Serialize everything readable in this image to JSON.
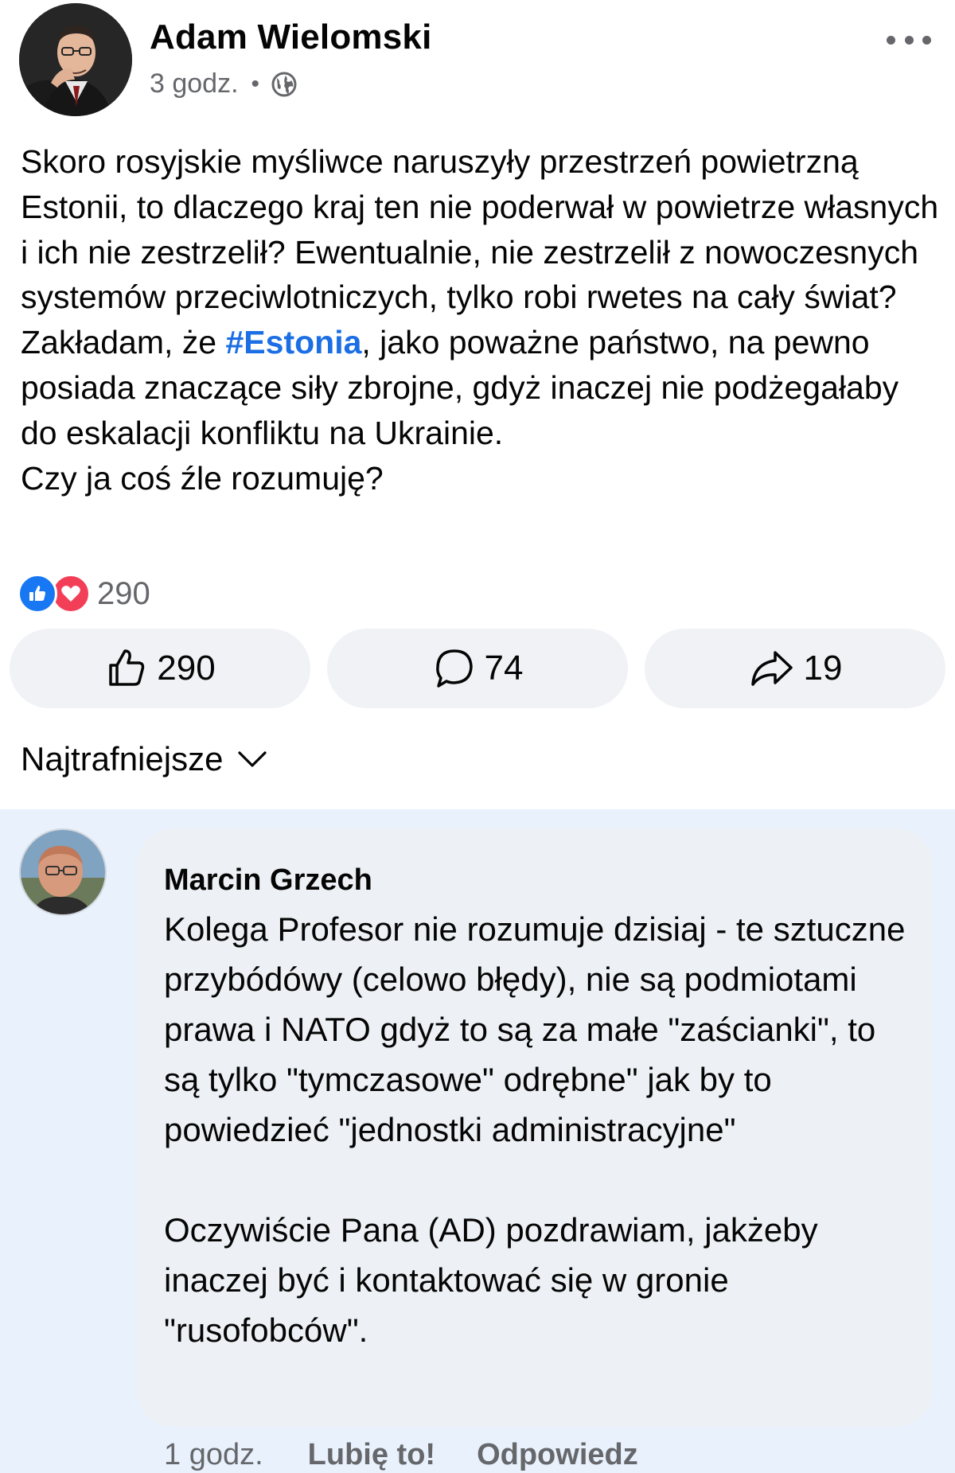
{
  "post": {
    "author_name": "Adam Wielomski",
    "time": "3 godz.",
    "separator": "•",
    "audience_icon": "globe-icon",
    "more_icon": "more-options-icon",
    "body_before_hashtag": "Skoro rosyjskie myśliwce naruszyły przestrzeń powietrzną Estonii, to dlaczego kraj ten nie poderwał w powietrze własnych i ich nie zestrzelił? Ewentualnie, nie zestrzelił z nowoczesnych systemów przeciwlotniczych, tylko robi rwetes na cały świat? Zakładam, że ",
    "hashtag": "#Estonia",
    "body_after_hashtag": ", jako poważne państwo, na pewno posiada znaczące siły zbrojne, gdyż inaczej nie podżegałaby do eskalacji konfliktu na Ukrainie.\nCzy ja coś źle rozumuję?",
    "reactions": {
      "types": [
        "like",
        "love"
      ],
      "count": "290"
    },
    "actions": {
      "like_count": "290",
      "comment_count": "74",
      "share_count": "19"
    }
  },
  "comments_sort": {
    "selected": "Najtrafniejsze"
  },
  "comment": {
    "author_name": "Marcin Grzech",
    "text": "Kolega Profesor nie rozumuje dzisiaj - te sztuczne przybódówy (celowo błędy), nie są podmiotami prawa i NATO gdyż to są za małe \"zaścianki\", to są tylko \"tymczasowe\" odrębne\" jak by to powiedzieć \"jednostki administracyjne\"\n\nOczywiście Pana (AD) pozdrawiam, jakżeby inaczej być i kontaktować się w gronie \"rusofobców\".",
    "time": "1 godz.",
    "like_label": "Lubię to!",
    "reply_label": "Odpowiedz"
  },
  "colors": {
    "hashtag": "#1b6ee4",
    "secondary_text": "#65676b",
    "button_bg": "#f0f2f5",
    "comment_section_bg": "#e8f1fc",
    "comment_bubble_bg": "#edf0f4",
    "like_blue": "#1877f2",
    "love_red": "#f33e58"
  }
}
